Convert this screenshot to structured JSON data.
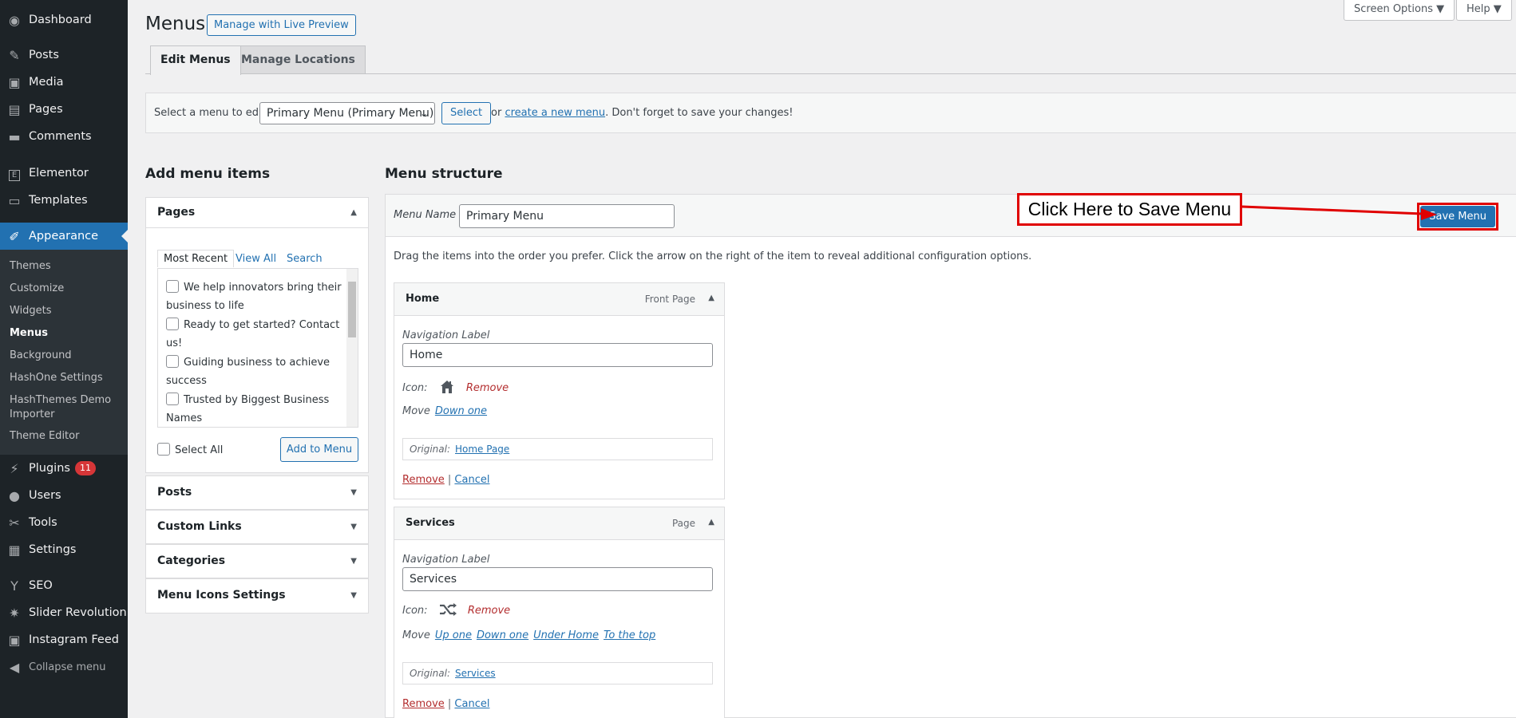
{
  "top": {
    "screen_options": "Screen Options ▼",
    "help": "Help ▼"
  },
  "sidebar": {
    "items": [
      {
        "label": "Dashboard",
        "icon": "dashboard-icon",
        "glyph": "◉"
      },
      {
        "label": "Posts",
        "icon": "pin-icon",
        "glyph": "✎"
      },
      {
        "label": "Media",
        "icon": "media-icon",
        "glyph": "▣"
      },
      {
        "label": "Pages",
        "icon": "pages-icon",
        "glyph": "▤"
      },
      {
        "label": "Comments",
        "icon": "comments-icon",
        "glyph": "▬"
      },
      {
        "label": "Elementor",
        "icon": "elementor-icon",
        "glyph": "E"
      },
      {
        "label": "Templates",
        "icon": "folder-icon",
        "glyph": "▭"
      },
      {
        "label": "Appearance",
        "icon": "brush-icon",
        "glyph": "✐"
      },
      {
        "label": "Plugins",
        "icon": "plugin-icon",
        "glyph": "⚡",
        "badge": "11"
      },
      {
        "label": "Users",
        "icon": "users-icon",
        "glyph": "●"
      },
      {
        "label": "Tools",
        "icon": "wrench-icon",
        "glyph": "✂"
      },
      {
        "label": "Settings",
        "icon": "settings-icon",
        "glyph": "▦"
      },
      {
        "label": "SEO",
        "icon": "yoast-icon",
        "glyph": "Y"
      },
      {
        "label": "Slider Revolution",
        "icon": "slider-icon",
        "glyph": "✷"
      },
      {
        "label": "Instagram Feed",
        "icon": "instagram-icon",
        "glyph": "▣"
      },
      {
        "label": "Collapse menu",
        "icon": "collapse-icon",
        "glyph": "◀"
      }
    ],
    "submenu": [
      "Themes",
      "Customize",
      "Widgets",
      "Menus",
      "Background",
      "HashOne Settings",
      "HashThemes Demo Importer",
      "Theme Editor"
    ]
  },
  "header": {
    "title": "Menus",
    "live_preview": "Manage with Live Preview",
    "tabs": [
      "Edit Menus",
      "Manage Locations"
    ]
  },
  "select_bar": {
    "label": "Select a menu to edit:",
    "selected": "Primary Menu (Primary Menu)",
    "button": "Select",
    "or": "or",
    "create_link": "create a new menu",
    "reminder": ". Don't forget to save your changes!"
  },
  "add_items": {
    "heading": "Add menu items",
    "pages_title": "Pages",
    "tabs": [
      "Most Recent",
      "View All",
      "Search"
    ],
    "pages": [
      "We help innovators bring their business to life",
      "Ready to get started? Contact us!",
      "Guiding business to achieve success",
      "Trusted by Biggest Business Names"
    ],
    "select_all": "Select All",
    "add_button": "Add to Menu",
    "sections": [
      "Posts",
      "Custom Links",
      "Categories",
      "Menu Icons Settings"
    ]
  },
  "structure": {
    "heading": "Menu structure",
    "menu_name_label": "Menu Name",
    "menu_name": "Primary Menu",
    "save_button": "Save Menu",
    "callout": "Click Here to Save Menu",
    "instructions": "Drag the items into the order you prefer. Click the arrow on the right of the item to reveal additional configuration options.",
    "items": [
      {
        "title": "Home",
        "type": "Front Page",
        "nav_label_caption": "Navigation Label",
        "nav_label": "Home",
        "icon_caption": "Icon:",
        "icon_name": "home-icon",
        "icon_remove": "Remove",
        "move_caption": "Move",
        "moves": [
          "Down one"
        ],
        "original_caption": "Original:",
        "original": "Home Page",
        "remove": "Remove",
        "cancel": "Cancel"
      },
      {
        "title": "Services",
        "type": "Page",
        "nav_label_caption": "Navigation Label",
        "nav_label": "Services",
        "icon_caption": "Icon:",
        "icon_name": "shuffle-icon",
        "icon_remove": "Remove",
        "move_caption": "Move",
        "moves": [
          "Up one",
          "Down one",
          "Under Home",
          "To the top"
        ],
        "original_caption": "Original:",
        "original": "Services",
        "remove": "Remove",
        "cancel": "Cancel"
      }
    ]
  },
  "colors": {
    "accent": "#2271b1",
    "sidebar": "#1d2327",
    "callout": "#e00000"
  }
}
